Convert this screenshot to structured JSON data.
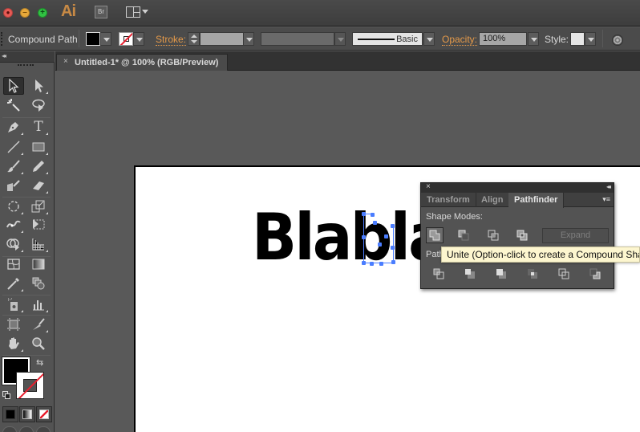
{
  "app": {
    "logo": "Ai",
    "bridge_label": "Br",
    "window_controls": [
      "close",
      "minimize",
      "zoom"
    ],
    "workspace_icon": "workspace-layout-icon"
  },
  "control_bar": {
    "selection_type": "Compound Path",
    "fill_color": "#000000",
    "stroke_color": "none",
    "stroke_label": "Stroke:",
    "stroke_weight": "",
    "variable_width": "",
    "brush_label": "Basic",
    "opacity_label": "Opacity:",
    "opacity_value": "100%",
    "style_label": "Style:",
    "style_swatch": "#e6e6e6"
  },
  "document": {
    "tab_title": "Untitled-1* @ 100% (RGB/Preview)",
    "tab_close": "×",
    "artwork_text": "Blabla",
    "selection_color": "#4a7dff"
  },
  "tools": [
    {
      "name": "selection-tool",
      "active": true
    },
    {
      "name": "direct-selection-tool"
    },
    {
      "name": "magic-wand-tool"
    },
    {
      "name": "lasso-tool"
    },
    {
      "name": "pen-tool"
    },
    {
      "name": "type-tool",
      "glyph": "T"
    },
    {
      "name": "line-segment-tool"
    },
    {
      "name": "rectangle-tool"
    },
    {
      "name": "paintbrush-tool"
    },
    {
      "name": "pencil-tool"
    },
    {
      "name": "blob-brush-tool"
    },
    {
      "name": "eraser-tool"
    },
    {
      "name": "rotate-tool"
    },
    {
      "name": "scale-tool"
    },
    {
      "name": "width-tool"
    },
    {
      "name": "free-transform-tool"
    },
    {
      "name": "shape-builder-tool"
    },
    {
      "name": "perspective-grid-tool"
    },
    {
      "name": "mesh-tool"
    },
    {
      "name": "gradient-tool"
    },
    {
      "name": "eyedropper-tool"
    },
    {
      "name": "blend-tool"
    },
    {
      "name": "symbol-sprayer-tool"
    },
    {
      "name": "column-graph-tool"
    },
    {
      "name": "artboard-tool"
    },
    {
      "name": "slice-tool"
    },
    {
      "name": "hand-tool"
    },
    {
      "name": "zoom-tool"
    }
  ],
  "color_controls": {
    "fill": "#000000",
    "stroke": "none",
    "swap_glyph": "⇆",
    "modes": [
      "color",
      "gradient",
      "none"
    ]
  },
  "pathfinder_panel": {
    "close": "×",
    "collapse": "◂◂",
    "menu": "▾≡",
    "tabs": [
      {
        "label": "Transform",
        "active": false
      },
      {
        "label": "Align",
        "active": false
      },
      {
        "label": "Pathfinder",
        "active": true
      }
    ],
    "shape_modes_label": "Shape Modes:",
    "shape_modes": [
      "Unite",
      "Minus Front",
      "Intersect",
      "Exclude"
    ],
    "expand_label": "Expand",
    "pathfinders_label": "Pathfinders:",
    "pathfinders_visible_label": "Path",
    "pathfinders": [
      "Divide",
      "Trim",
      "Merge",
      "Crop",
      "Outline",
      "Minus Back"
    ]
  },
  "tooltip": {
    "text": "Unite (Option-click to create a Compound Shape)"
  }
}
